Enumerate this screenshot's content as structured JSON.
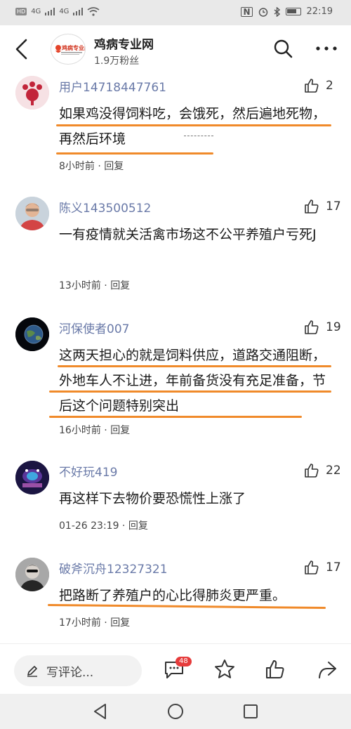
{
  "status_bar": {
    "left_chips": [
      "HD",
      "HD"
    ],
    "signal_left": "4G",
    "signal_right": "4G",
    "time": "22:19"
  },
  "header": {
    "account_name": "鸡病专业网",
    "fans": "1.9万粉丝",
    "logo_text": "鸡病专业网"
  },
  "comments": [
    {
      "username": "用户14718447761",
      "likes": "2",
      "text": "如果鸡没得饲料吃，会饿死，然后遍地死物，再然后环境",
      "time": "8小时前",
      "reply": "回复"
    },
    {
      "username": "陈义143500512",
      "likes": "17",
      "text": "一有疫情就关活禽市场这不公平养殖户亏死J",
      "time": "13小时前",
      "reply": "回复"
    },
    {
      "username": "河保使者007",
      "likes": "19",
      "text": "这两天担心的就是饲料供应，道路交通阻断，外地车人不让进，年前备货没有充足准备，节后这个问题特别突出",
      "time": "16小时前",
      "reply": "回复"
    },
    {
      "username": "不好玩419",
      "likes": "22",
      "text": "再这样下去物价要恐慌性上涨了",
      "time": "01-26 23:19",
      "reply": "回复"
    },
    {
      "username": "破斧沉舟12327321",
      "likes": "17",
      "text": "把路断了养殖户的心比得肺炎更严重。",
      "time": "17小时前",
      "reply": "回复"
    }
  ],
  "meta_separator": " · ",
  "toolbar": {
    "write_placeholder": "写评论...",
    "comment_count": "48"
  },
  "colors": {
    "username": "#6a7aa8",
    "underline": "#f08a2a",
    "badge": "#e63b3b"
  }
}
